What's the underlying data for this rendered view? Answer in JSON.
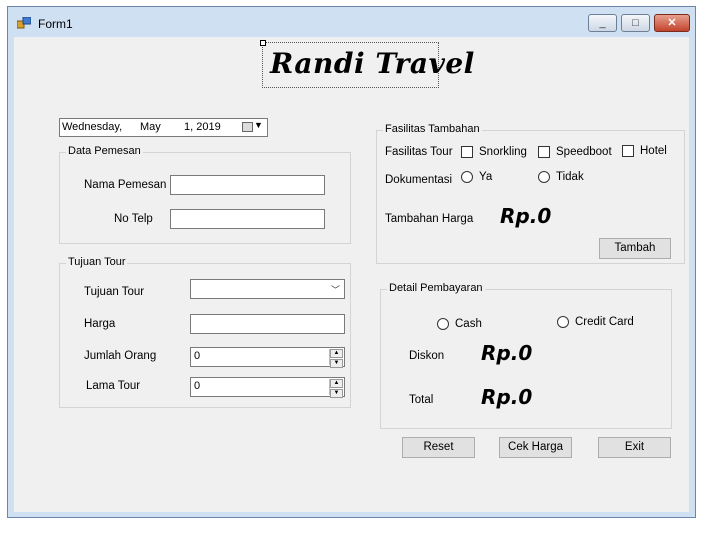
{
  "window": {
    "title": "Form1",
    "minimize_glyph": "_",
    "maximize_glyph": "□",
    "close_glyph": "✕"
  },
  "logo": {
    "text": "Randi Travel"
  },
  "date_picker": {
    "day": "Wednesday,",
    "month": "May",
    "date": "1, 2019"
  },
  "data_pemesan": {
    "title": "Data Pemesan",
    "nama_label": "Nama Pemesan",
    "nama_value": "",
    "telp_label": "No Telp",
    "telp_value": ""
  },
  "tujuan_tour": {
    "title": "Tujuan Tour",
    "tujuan_label": "Tujuan Tour",
    "tujuan_value": "",
    "harga_label": "Harga",
    "harga_value": "",
    "jumlah_label": "Jumlah Orang",
    "jumlah_value": "0",
    "lama_label": "Lama Tour",
    "lama_value": "0"
  },
  "fasilitas": {
    "title": "Fasilitas Tambahan",
    "tour_label": "Fasilitas Tour",
    "options": [
      "Snorkling",
      "Speedboot",
      "Hotel"
    ],
    "dokumentasi_label": "Dokumentasi",
    "dok_options": [
      "Ya",
      "Tidak"
    ],
    "tambahan_label": "Tambahan Harga",
    "tambahan_value": "Rp.0",
    "tambah_button": "Tambah"
  },
  "pembayaran": {
    "title": "Detail Pembayaran",
    "methods": [
      "Cash",
      "Credit Card"
    ],
    "diskon_label": "Diskon",
    "diskon_value": "Rp.0",
    "total_label": "Total",
    "total_value": "Rp.0"
  },
  "actions": {
    "reset": "Reset",
    "cek_harga": "Cek Harga",
    "exit": "Exit"
  }
}
